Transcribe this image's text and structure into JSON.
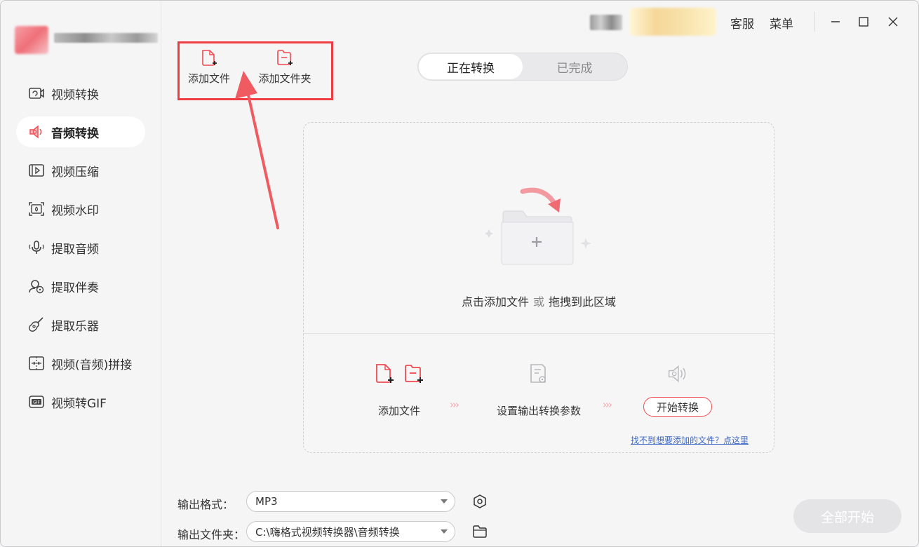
{
  "titlebar": {
    "service_label": "客服",
    "menu_label": "菜单"
  },
  "sidebar": {
    "items": [
      {
        "label": "视频转换",
        "icon": "video-convert-icon"
      },
      {
        "label": "音频转换",
        "icon": "audio-convert-icon",
        "active": true
      },
      {
        "label": "视频压缩",
        "icon": "video-compress-icon"
      },
      {
        "label": "视频水印",
        "icon": "video-watermark-icon"
      },
      {
        "label": "提取音频",
        "icon": "extract-audio-icon"
      },
      {
        "label": "提取伴奏",
        "icon": "extract-accompaniment-icon"
      },
      {
        "label": "提取乐器",
        "icon": "extract-instrument-icon"
      },
      {
        "label": "视频(音频)拼接",
        "icon": "merge-icon"
      },
      {
        "label": "视频转GIF",
        "icon": "gif-icon"
      }
    ]
  },
  "toolbar": {
    "add_file_label": "添加文件",
    "add_folder_label": "添加文件夹"
  },
  "tabs": {
    "converting": "正在转换",
    "completed": "已完成"
  },
  "dropzone": {
    "hint_click": "点击添加文件",
    "hint_or": "或",
    "hint_drag": "拖拽到此区域",
    "step1_label": "添加文件",
    "step2_label": "设置输出转换参数",
    "step3_label": "开始转换",
    "help_link": "找不到想要添加的文件？点这里"
  },
  "settings": {
    "format_label": "输出格式：",
    "format_value": "MP3",
    "folder_label": "输出文件夹：",
    "folder_value": "C:\\嗨格式视频转换器\\音频转换"
  },
  "actions": {
    "start_all_label": "全部开始"
  },
  "colors": {
    "accent": "#ef4a52",
    "highlight_box": "#ef3b42",
    "arrow": "#f05b62",
    "link": "#3b66c4"
  }
}
